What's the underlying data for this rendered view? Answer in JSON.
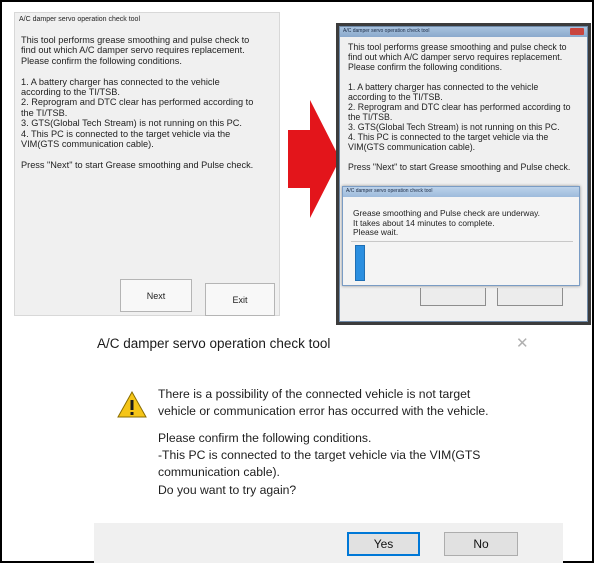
{
  "left_window": {
    "title": "A/C damper servo operation check tool",
    "body": "This tool performs grease smoothing and pulse check to\nfind out which A/C damper servo requires replacement.\nPlease confirm the following conditions.\n\n1. A battery charger has connected to the vehicle\naccording to the TI/TSB.\n2. Reprogram and DTC clear has performed according to\nthe TI/TSB.\n3. GTS(Global Tech Stream) is not running on this PC.\n4. This PC is connected to the target vehicle via the\nVIM(GTS communication cable).\n\nPress \"Next\" to start Grease smoothing and Pulse check.",
    "next_label": "Next",
    "exit_label": "Exit"
  },
  "right_window": {
    "title": "A/C damper servo operation check tool",
    "body": "This tool performs grease smoothing and pulse check to\nfind out which A/C damper servo requires replacement.\nPlease confirm the following conditions.\n\n1. A battery charger has connected to the vehicle\naccording to the TI/TSB.\n2. Reprogram and DTC clear has performed according to\nthe TI/TSB.\n3. GTS(Global Tech Stream) is not running on this PC.\n4. This PC is connected to the target vehicle via the\nVIM(GTS communication cable).\n\nPress \"Next\" to start Grease smoothing and Pulse check."
  },
  "progress_popup": {
    "title": "A/C damper servo operation check tool",
    "message": "Grease smoothing and Pulse check are underway.\nIt takes about 14 minutes to complete.\nPlease wait."
  },
  "arrow_color": "#e3151b",
  "dialog": {
    "title": "A/C damper servo operation check tool",
    "close_glyph": "✕",
    "icon": "warning-icon",
    "message_1": "There is a possibility of the connected vehicle is not target\nvehicle or communication error has occurred with the vehicle.",
    "message_2": "Please confirm the following conditions.\n-This PC is connected to the target vehicle via the VIM(GTS\ncommunication cable).",
    "message_3": "Do you want to try again?",
    "yes_label": "Yes",
    "no_label": "No",
    "accent_color": "#0078d7"
  }
}
